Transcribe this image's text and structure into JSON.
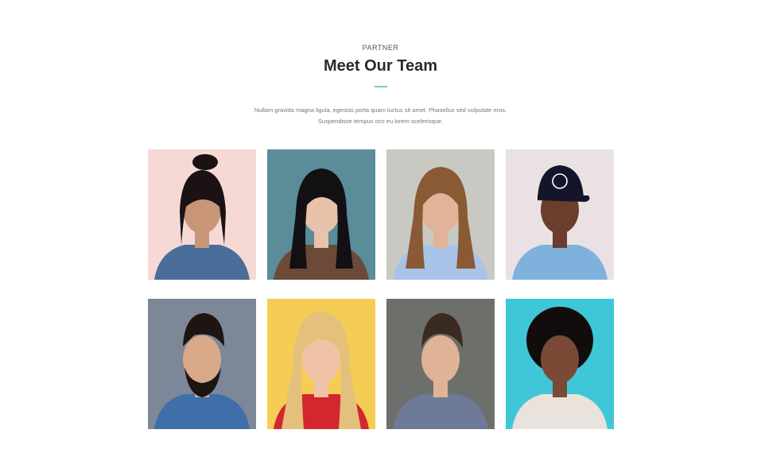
{
  "section": {
    "eyebrow": "PARTNER",
    "title": "Meet Our Team",
    "description_line1": "Nullam gravida magna ligula, egestas porta quam luctus sit amet. Phasellus sed vulputate eros.",
    "description_line2": "Suspendisse tempus orci eu lorem scelerisque.",
    "accent_color": "#6fcfc3"
  },
  "team": [
    {
      "bg": "#f6d9d4",
      "skin": "#c89677",
      "hair": "#1a1214",
      "shirt": "#4a6e99",
      "style": "bun"
    },
    {
      "bg": "#5a8c9a",
      "skin": "#e8c2aa",
      "hair": "#121013",
      "shirt": "#6b4a3a",
      "style": "long-dark"
    },
    {
      "bg": "#c9c9c4",
      "skin": "#e2b398",
      "hair": "#8a5a35",
      "shirt": "#a9c3e8",
      "style": "long-brown"
    },
    {
      "bg": "#eae1e4",
      "skin": "#6a3d2c",
      "hair": "#14142a",
      "shirt": "#7fb1dd",
      "style": "cap"
    },
    {
      "bg": "#7c8798",
      "skin": "#d9a98a",
      "hair": "#1c1512",
      "shirt": "#3e6fa8",
      "style": "beard"
    },
    {
      "bg": "#f5cd54",
      "skin": "#f0c2a6",
      "hair": "#e3c07c",
      "shirt": "#d3262f",
      "style": "long-blonde"
    },
    {
      "bg": "#6c6f6a",
      "skin": "#e0b396",
      "hair": "#3a2a22",
      "shirt": "#6d7a98",
      "style": "short"
    },
    {
      "bg": "#3fc7d7",
      "skin": "#7a4a36",
      "hair": "#120d0c",
      "shirt": "#e9e2dd",
      "style": "afro"
    }
  ]
}
